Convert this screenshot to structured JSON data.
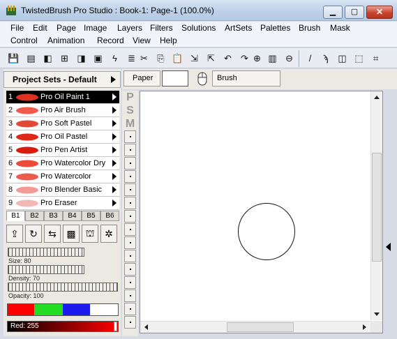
{
  "window": {
    "title": "TwistedBrush Pro Studio : Book-1: Page-1 (100.0%)"
  },
  "menus": {
    "row1": [
      "File",
      "Edit",
      "Page",
      "Image",
      "Layers",
      "Filters",
      "Solutions",
      "ArtSets",
      "Palettes",
      "Brush",
      "Mask"
    ],
    "row2": [
      "Control",
      "Animation",
      "Record",
      "View",
      "Help"
    ]
  },
  "toolbar": {
    "icons": [
      "save-icon",
      "book-icon",
      "page-prev-icon",
      "page-add-icon",
      "page-next-icon",
      "page-last-icon",
      "lightning-icon",
      "script-icon",
      "scissors-icon",
      "copy-icon",
      "paste-icon",
      "paste-layer-icon",
      "paste-new-icon",
      "undo-icon",
      "redo-icon",
      "zoom-in-icon",
      "actual-size-icon",
      "zoom-out-icon",
      "brush-tool-icon",
      "eyedropper-icon",
      "bucket-icon",
      "select-icon",
      "crop-icon"
    ]
  },
  "project_sets": {
    "label": "Project Sets - Default"
  },
  "brushes": [
    {
      "num": "1",
      "label": "Pro Oil Paint 1",
      "selected": true,
      "color": "#e03020"
    },
    {
      "num": "2",
      "label": "Pro Air Brush",
      "selected": false,
      "color": "#f05a4a"
    },
    {
      "num": "3",
      "label": "Pro Soft Pastel",
      "selected": false,
      "color": "#e64838"
    },
    {
      "num": "4",
      "label": "Pro Oil Pastel",
      "selected": false,
      "color": "#e02818"
    },
    {
      "num": "5",
      "label": "Pro Pen Artist",
      "selected": false,
      "color": "#d81c10"
    },
    {
      "num": "6",
      "label": "Pro Watercolor Dry",
      "selected": false,
      "color": "#ec4a3a"
    },
    {
      "num": "7",
      "label": "Pro Watercolor",
      "selected": false,
      "color": "#ee5a4c"
    },
    {
      "num": "8",
      "label": "Pro Blender Basic",
      "selected": false,
      "color": "#f49a94"
    },
    {
      "num": "9",
      "label": "Pro Eraser",
      "selected": false,
      "color": "#f2b8b4"
    }
  ],
  "banks": [
    "B1",
    "B2",
    "B3",
    "B4",
    "B5",
    "B6"
  ],
  "active_bank": "B1",
  "panel_buttons": [
    "export-icon",
    "refresh-icon",
    "randomize-icon",
    "stroke-icon",
    "lock-icon",
    "settings-icon"
  ],
  "sliders": {
    "size": {
      "label": "Size: 80",
      "value": 80
    },
    "density": {
      "label": "Density: 70",
      "value": 70
    },
    "opacity": {
      "label": "Opacity: 100",
      "value": 100
    }
  },
  "colors": {
    "swatches": [
      "#ff0000",
      "#22dd22",
      "#1a1aee",
      "#ffffff"
    ],
    "red": {
      "label": "Red: 255",
      "value": 255
    }
  },
  "psm": [
    "P",
    "S",
    "M"
  ],
  "paper_bar": {
    "paper_label": "Paper",
    "brush_label": "Brush"
  }
}
